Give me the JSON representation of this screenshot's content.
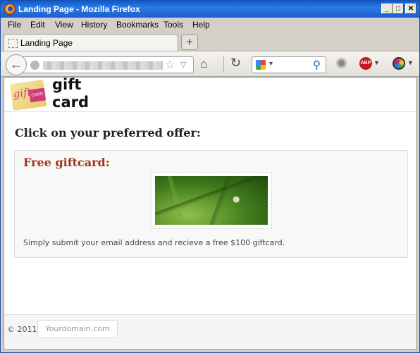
{
  "window": {
    "title": "Landing Page - Mozilla Firefox"
  },
  "menu": {
    "items": [
      {
        "label": "File"
      },
      {
        "label": "Edit"
      },
      {
        "label": "View"
      },
      {
        "label": "History"
      },
      {
        "label": "Bookmarks"
      },
      {
        "label": "Tools"
      },
      {
        "label": "Help"
      }
    ]
  },
  "tabs": [
    {
      "label": "Landing Page"
    }
  ],
  "newtab_label": "+",
  "navbar": {
    "icons": [
      "back-icon",
      "globe-icon",
      "star-icon",
      "home-icon",
      "reload-icon",
      "google-icon",
      "magnifier-icon",
      "addon-icon",
      "adblock-icon",
      "color-picker-icon"
    ],
    "abp_label": "ABP"
  },
  "site": {
    "logo_card_text": "gift",
    "logo_tag_text": "CARD",
    "logo_text_line1": "gift",
    "logo_text_line2": "card"
  },
  "main": {
    "heading": "Click on your preferred offer:",
    "offer": {
      "title": "Free giftcard:",
      "description": "Simply submit your email address and recieve a free $100 giftcard."
    }
  },
  "footer": {
    "copyright": "© 2011",
    "domain": "Yourdomain.com"
  }
}
